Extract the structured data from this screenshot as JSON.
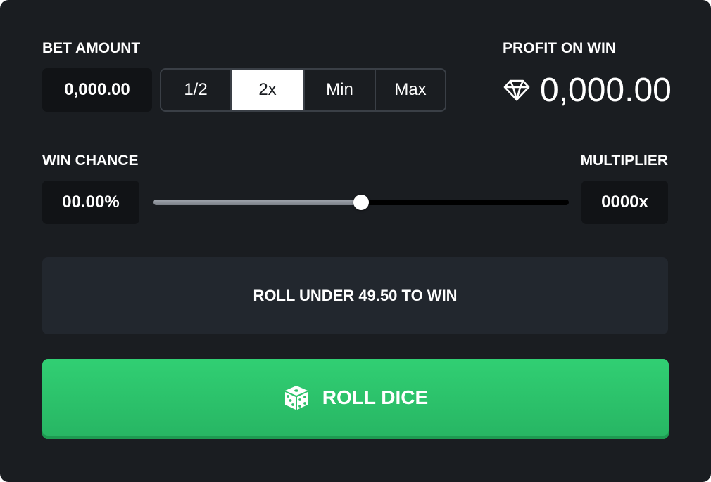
{
  "bet": {
    "label": "BET AMOUNT",
    "value": "0,000.00",
    "modifiers": [
      "1/2",
      "2x",
      "Min",
      "Max"
    ],
    "active_modifier": "2x"
  },
  "profit": {
    "label": "PROFIT ON WIN",
    "value": "0,000.00",
    "icon": "diamond-icon"
  },
  "win_chance": {
    "label": "WIN CHANCE",
    "value": "00.00%"
  },
  "multiplier": {
    "label": "MULTIPLIER",
    "value": "0000x"
  },
  "slider": {
    "value_percent": 50
  },
  "roll_info": {
    "text": "ROLL UNDER 49.50 TO WIN"
  },
  "roll_button": {
    "label": "ROLL DICE",
    "icon": "dice-icon"
  },
  "colors": {
    "background": "#1a1d21",
    "input_bg": "#111316",
    "info_bg": "#22272e",
    "accent_green": "#2ec56c",
    "border": "#3a3f46"
  }
}
